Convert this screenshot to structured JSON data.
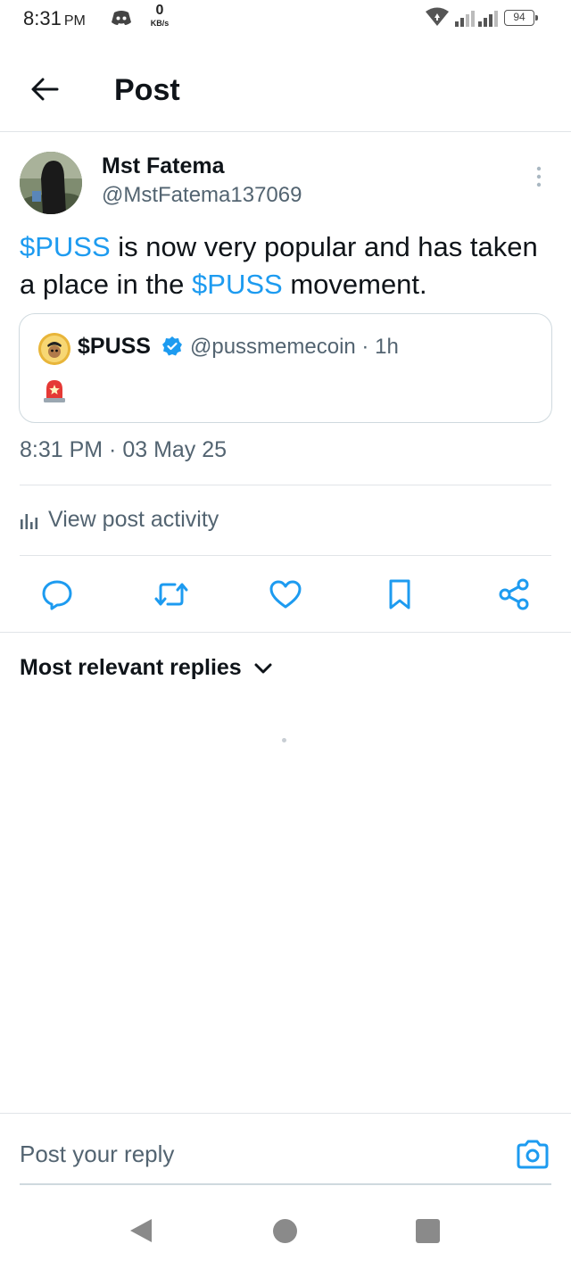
{
  "status_bar": {
    "time": "8:31",
    "ampm": "PM",
    "net_speed_value": "0",
    "net_speed_unit": "KB/s",
    "battery": "94",
    "icons": [
      "discord-icon",
      "wifi-icon",
      "signal-icon",
      "signal-icon",
      "battery-icon"
    ]
  },
  "header": {
    "title": "Post",
    "back_icon": "arrow-left-icon"
  },
  "post": {
    "author_name": "Mst Fatema",
    "author_handle": "@MstFatema137069",
    "text_segments": [
      {
        "text": "$PUSS",
        "type": "cashtag"
      },
      {
        "text": " is now very popular and has taken a place in the ",
        "type": "plain"
      },
      {
        "text": "$PUSS",
        "type": "cashtag"
      },
      {
        "text": " movement.",
        "type": "plain"
      }
    ],
    "timestamp": "8:31 PM · 03 May 25",
    "activity_label": "View post activity"
  },
  "quote": {
    "name": "$PUSS",
    "handle_time": "@pussmemecoin · 1h",
    "verified": true,
    "content_emoji": "siren-icon"
  },
  "actions": [
    "reply-icon",
    "repost-icon",
    "like-icon",
    "bookmark-icon",
    "share-icon"
  ],
  "replies": {
    "sort_label": "Most relevant replies"
  },
  "reply_bar": {
    "placeholder": "Post your reply"
  },
  "colors": {
    "accent": "#1d9bf0",
    "text_primary": "#0f1419",
    "text_secondary": "#536471",
    "divider": "#e1e4e8"
  }
}
